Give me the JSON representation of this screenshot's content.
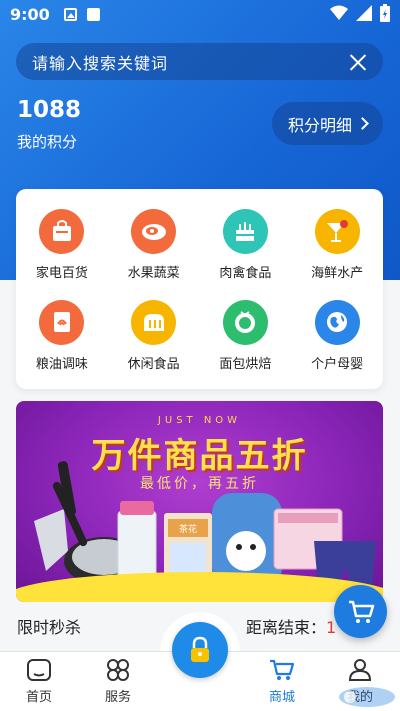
{
  "status_bar": {
    "time": "9:00"
  },
  "search": {
    "placeholder": "请输入搜索关键词"
  },
  "points": {
    "value": "1088",
    "label": "我的积分",
    "detail_button": "积分明细"
  },
  "categories": [
    {
      "label": "家电百货",
      "icon": "shopping-bag-icon",
      "color": "#f36b3c"
    },
    {
      "label": "水果蔬菜",
      "icon": "fruit-icon",
      "color": "#f36b3c"
    },
    {
      "label": "肉禽食品",
      "icon": "cake-icon",
      "color": "#2ec4b6"
    },
    {
      "label": "海鲜水产",
      "icon": "cocktail-icon",
      "color": "#f7b500"
    },
    {
      "label": "粮油调味",
      "icon": "card-icon",
      "color": "#f36b3c"
    },
    {
      "label": "休闲食品",
      "icon": "bread-icon",
      "color": "#f7b500"
    },
    {
      "label": "面包烘焙",
      "icon": "tomato-icon",
      "color": "#2dbd6e"
    },
    {
      "label": "个户母婴",
      "icon": "globe-icon",
      "color": "#2a86e8"
    }
  ],
  "banner": {
    "just_now": "JUST NOW",
    "title": "万件商品五折",
    "subtitle": "最低价，再五折",
    "product_text": "茶花"
  },
  "flash_sale": {
    "title": "限时秒杀",
    "countdown_label": "距离结束：",
    "countdown_value": "1"
  },
  "bottom_nav": [
    {
      "label": "首页",
      "icon": "home-icon"
    },
    {
      "label": "服务",
      "icon": "services-icon"
    },
    {
      "label": "商城",
      "icon": "cart-icon",
      "active": true
    },
    {
      "label": "我的",
      "icon": "profile-icon"
    }
  ],
  "colors": {
    "primary": "#1e7be0",
    "header": "#1766d6",
    "countdown": "#e53935"
  }
}
